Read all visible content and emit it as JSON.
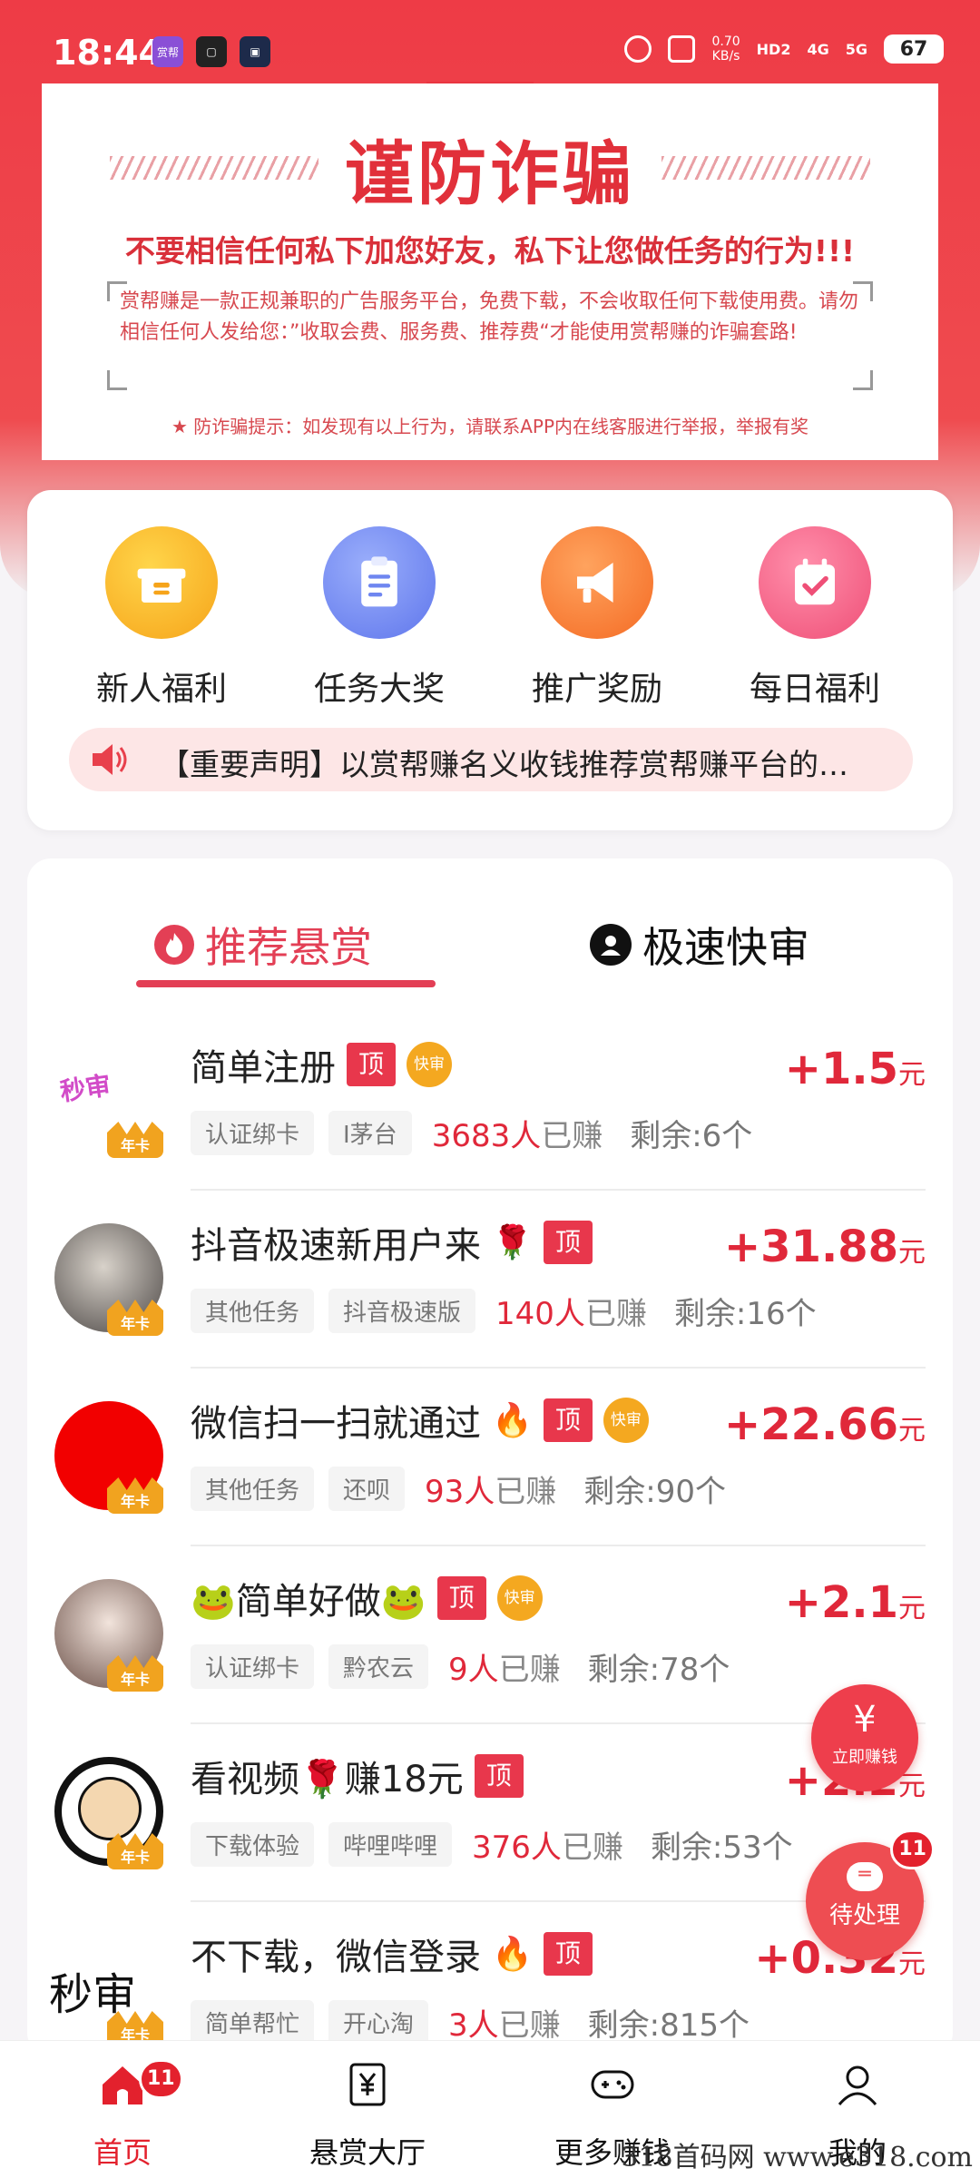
{
  "status_bar": {
    "time": "18:44",
    "app_icons": [
      "赏帮",
      "▢",
      "▣"
    ],
    "speed_value": "0.70",
    "speed_unit": "KB/s",
    "hd": "HD2",
    "net1": "4G",
    "net2": "5G",
    "battery": "67"
  },
  "notice": {
    "title": "谨防诈骗",
    "subtitle": "不要相信任何私下加您好友，私下让您做任务的行为!!!",
    "body": "赏帮赚是一款正规兼职的广告服务平台，免费下载，不会收取任何下载使用费。请勿相信任何人发给您：”收取会费、服务费、推荐费“才能使用赏帮赚的诈骗套路!",
    "tip": "★ 防诈骗提示：如发现有以上行为，请联系APP内在线客服进行举报，举报有奖"
  },
  "menu": {
    "items": [
      {
        "label": "新人福利",
        "icon": "gift-box-icon",
        "color": "#f6b21e"
      },
      {
        "label": "任务大奖",
        "icon": "clipboard-icon",
        "color": "#6f86f0"
      },
      {
        "label": "推广奖励",
        "icon": "megaphone-icon",
        "color": "#f77a2b"
      },
      {
        "label": "每日福利",
        "icon": "calendar-check-icon",
        "color": "#f25a7d"
      }
    ],
    "announcement": "【重要声明】以赏帮赚名义收钱推荐赏帮赚平台的…"
  },
  "tabs": {
    "recommended": "推荐悬赏",
    "fast": "极速快审"
  },
  "tasks": [
    {
      "avatar_text": "秒审",
      "title": "简单注册",
      "emoji": "",
      "top_tag": "顶",
      "fast_tag": "快审",
      "price_sign": "+",
      "price": "1.5",
      "unit": "元",
      "chips": [
        "认证绑卡",
        "I茅台"
      ],
      "earned_count": "3683人",
      "earned_label": "已赚",
      "remain": "剩余:6个",
      "crown": "年卡"
    },
    {
      "avatar_text": "",
      "title": "抖音极速新用户来",
      "emoji": "🌹",
      "top_tag": "顶",
      "fast_tag": "",
      "price_sign": "+",
      "price": "31.88",
      "unit": "元",
      "chips": [
        "其他任务",
        "抖音极速版"
      ],
      "earned_count": "140人",
      "earned_label": "已赚",
      "remain": "剩余:16个",
      "crown": "年卡"
    },
    {
      "avatar_text": "",
      "title": "微信扫一扫就通过",
      "emoji": "🔥",
      "top_tag": "顶",
      "fast_tag": "快审",
      "price_sign": "+",
      "price": "22.66",
      "unit": "元",
      "chips": [
        "其他任务",
        "还呗"
      ],
      "earned_count": "93人",
      "earned_label": "已赚",
      "remain": "剩余:90个",
      "crown": "年卡"
    },
    {
      "avatar_text": "",
      "title": "🐸简单好做🐸",
      "emoji": "",
      "top_tag": "顶",
      "fast_tag": "快审",
      "price_sign": "+",
      "price": "2.1",
      "unit": "元",
      "chips": [
        "认证绑卡",
        "黔农云"
      ],
      "earned_count": "9人",
      "earned_label": "已赚",
      "remain": "剩余:78个",
      "crown": "年卡"
    },
    {
      "avatar_text": "",
      "title": "看视频🌹赚18元",
      "emoji": "",
      "top_tag": "顶",
      "fast_tag": "",
      "price_sign": "+",
      "price": "2.2",
      "unit": "元",
      "chips": [
        "下载体验",
        "哔哩哔哩"
      ],
      "earned_count": "376人",
      "earned_label": "已赚",
      "remain": "剩余:53个",
      "crown": "年卡"
    },
    {
      "avatar_text": "秒审",
      "title": "不下载，微信登录",
      "emoji": "🔥",
      "top_tag": "顶",
      "fast_tag": "",
      "price_sign": "+",
      "price": "0.32",
      "unit": "元",
      "chips": [
        "简单帮忙",
        "开心淘"
      ],
      "earned_count": "3人",
      "earned_label": "已赚",
      "remain": "剩余:815个",
      "crown": "年卡"
    }
  ],
  "floating": {
    "earn_symbol": "¥",
    "earn_label": "立即赚钱",
    "pending_label": "待处理",
    "pending_badge": "11"
  },
  "bottom_nav": {
    "items": [
      {
        "label": "首页",
        "badge": "11"
      },
      {
        "label": "悬赏大厅"
      },
      {
        "label": "更多赚钱"
      },
      {
        "label": "我的"
      }
    ]
  },
  "watermark": "318首码网 www.e318.com"
}
